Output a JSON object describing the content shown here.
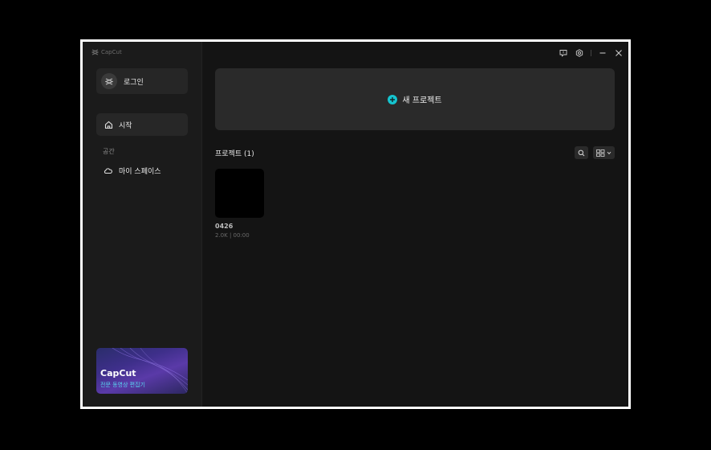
{
  "app": {
    "brand": "CapCut"
  },
  "sidebar": {
    "login_label": "로그인",
    "nav": [
      {
        "label": "시작",
        "icon": "home-icon"
      }
    ],
    "section_label": "공간",
    "space_item": {
      "label": "마이 스페이스",
      "icon": "cloud-icon"
    },
    "promo": {
      "title": "CapCut",
      "subtitle": "전문 동영상 편집기"
    }
  },
  "main": {
    "new_project_label": "새 프로젝트",
    "projects_title": "프로젝트  (1)",
    "projects": [
      {
        "name": "0426",
        "meta": "2.0K | 00:00"
      }
    ]
  },
  "window_controls": [
    "feedback-icon",
    "settings-icon",
    "minimize-icon",
    "close-icon"
  ],
  "colors": {
    "accent": "#15c4cf",
    "background": "#141414",
    "sidebar": "#1b1b1b"
  }
}
